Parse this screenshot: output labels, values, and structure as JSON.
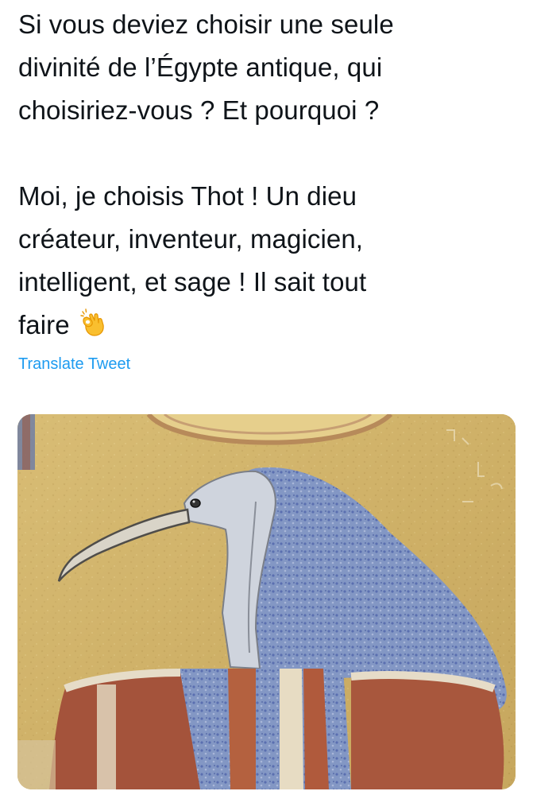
{
  "tweet": {
    "text_lines_1": [
      "Si vous deviez choisir une seule",
      "divinité de l’Égypte antique, qui",
      "choisiriez-vous ? Et pourquoi ?"
    ],
    "text_lines_2": [
      "Moi, je choisis Thot ! Un dieu",
      "créateur, inventeur, magicien,",
      "intelligent, et sage ! Il sait tout",
      "faire"
    ],
    "emoji": "ok-hand-emoji",
    "translate_label": "Translate Tweet",
    "media": {
      "icon": "thoth-ibis-relief-image"
    }
  },
  "colors": {
    "text": "#0f1419",
    "link": "#1d9bf0",
    "background": "#ffffff"
  }
}
